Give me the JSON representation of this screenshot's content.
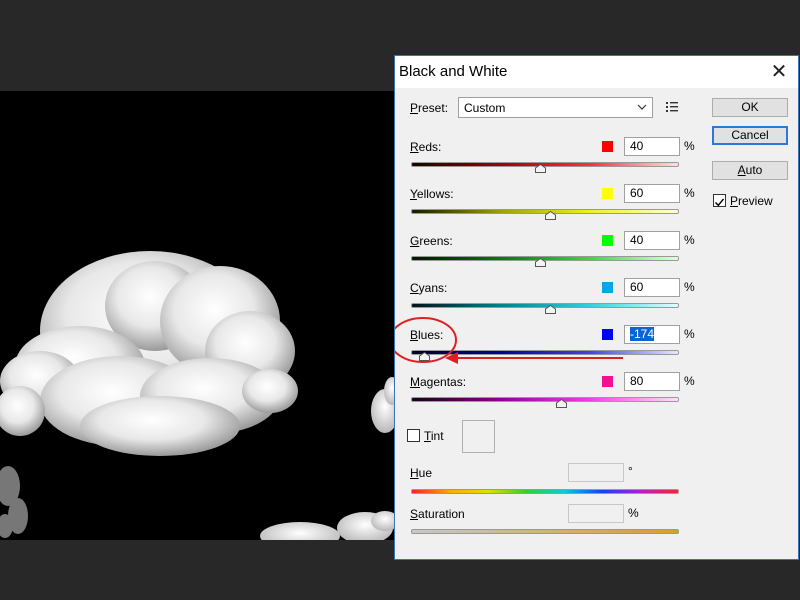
{
  "dialog": {
    "title": "Black and White",
    "preset": {
      "label_prefix": "",
      "label_underline": "P",
      "label_rest": "reset:",
      "value": "Custom"
    },
    "buttons": {
      "ok": "OK",
      "cancel": "Cancel",
      "auto_prefix": "",
      "auto_underline": "A",
      "auto_rest": "uto"
    },
    "preview": {
      "underline": "P",
      "rest": "review",
      "checked": true
    },
    "sliders": [
      {
        "id": "reds",
        "underline": "R",
        "rest": "eds:",
        "value": "40",
        "percent": "%",
        "color": "#ff0000",
        "level": 0.48
      },
      {
        "id": "yellows",
        "underline": "Y",
        "rest": "ellows:",
        "value": "60",
        "percent": "%",
        "color": "#ffff00",
        "level": 0.52
      },
      {
        "id": "greens",
        "underline": "G",
        "rest": "reens:",
        "value": "40",
        "percent": "%",
        "color": "#00ff00",
        "level": 0.48
      },
      {
        "id": "cyans",
        "underline": "C",
        "rest": "yans:",
        "value": "60",
        "percent": "%",
        "color": "#00a8e8",
        "level": 0.52
      },
      {
        "id": "blues",
        "underline": "B",
        "rest": "lues:",
        "value": "-174",
        "percent": "%",
        "color": "#0000ff",
        "level": 0.05
      },
      {
        "id": "magentas",
        "underline": "M",
        "rest": "agentas:",
        "value": "80",
        "percent": "%",
        "color": "#f01090",
        "level": 0.56
      }
    ],
    "tint": {
      "underline": "T",
      "rest": "int",
      "checked": false
    },
    "hue": {
      "underline": "H",
      "rest": "ue",
      "unit": "°"
    },
    "saturation": {
      "underline": "S",
      "rest": "aturation",
      "unit": "%"
    }
  },
  "colors": {
    "dialog_border": "#3a72b8",
    "annotation_red": "#e02020",
    "selection_blue": "#0a64d6"
  },
  "icons": {
    "close": "close-icon",
    "preset_menu": "list-menu-icon",
    "dropdown": "chevron-down-icon",
    "checkbox": "checkmark-icon"
  }
}
